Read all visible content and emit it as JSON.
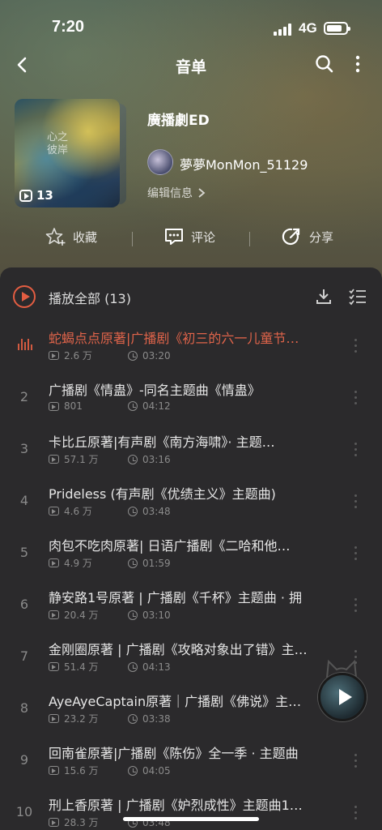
{
  "status_bar": {
    "time": "7:20",
    "network": "4G"
  },
  "header": {
    "title": "音单"
  },
  "playlist": {
    "title": "廣播劇ED",
    "cover_text_line1": "心之",
    "cover_text_line2": "彼岸",
    "count": "13",
    "author": "夢夢MonMon_51129",
    "edit_label": "编辑信息"
  },
  "actions": {
    "collect": "收藏",
    "comment": "评论",
    "share": "分享"
  },
  "list": {
    "play_all": "播放全部 (13)",
    "songs": [
      {
        "index": "",
        "title": "蛇蝎点点原著|广播剧《初三的六一儿童节…",
        "plays": "2.6 万",
        "duration": "03:20",
        "playing": true
      },
      {
        "index": "2",
        "title": "广播剧《情蛊》-同名主题曲《情蛊》",
        "plays": "801",
        "duration": "04:12"
      },
      {
        "index": "3",
        "title": "卡比丘原著|有声剧《南方海啸》· 主题…",
        "plays": "57.1 万",
        "duration": "03:16"
      },
      {
        "index": "4",
        "title": "Prideless (有声剧《优绩主义》主题曲)",
        "plays": "4.6 万",
        "duration": "03:48"
      },
      {
        "index": "5",
        "title": "肉包不吃肉原著| 日语广播剧《二哈和他…",
        "plays": "4.9 万",
        "duration": "01:59"
      },
      {
        "index": "6",
        "title": "静安路1号原著 | 广播剧《千杯》主题曲 · 拥",
        "plays": "20.4 万",
        "duration": "03:10"
      },
      {
        "index": "7",
        "title": "金刚圈原著 | 广播剧《攻略对象出了错》主…",
        "plays": "51.4 万",
        "duration": "04:13"
      },
      {
        "index": "8",
        "title": "AyeAyeCaptain原著｜广播剧《佛说》主…",
        "plays": "23.2 万",
        "duration": "03:38"
      },
      {
        "index": "9",
        "title": "回南雀原著|广播剧《陈伤》全一季 · 主题曲",
        "plays": "15.6 万",
        "duration": "04:05"
      },
      {
        "index": "10",
        "title": "刑上香原著 | 广播剧《妒烈成性》主题曲1…",
        "plays": "28.3 万",
        "duration": "03:48"
      }
    ]
  },
  "colors": {
    "accent": "#e0644a",
    "panel": "#2b2a2c"
  }
}
